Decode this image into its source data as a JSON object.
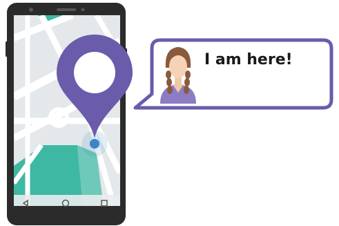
{
  "speech_bubble": {
    "message": "I am here!",
    "border_color": "#6a5bab"
  },
  "phone": {
    "body_color": "#2b2b2b",
    "nav_buttons": [
      "back-icon",
      "home-icon",
      "recent-apps-icon"
    ]
  },
  "map": {
    "background_color": "#e4e8ea",
    "road_color": "#ffffff",
    "park_color": "#3fb8a3"
  },
  "location_pin": {
    "color": "#6a5bab",
    "dot_color": "#3a86c8"
  },
  "avatar": {
    "hair_color": "#8a5a3c",
    "shirt_color": "#8c7cc4"
  }
}
